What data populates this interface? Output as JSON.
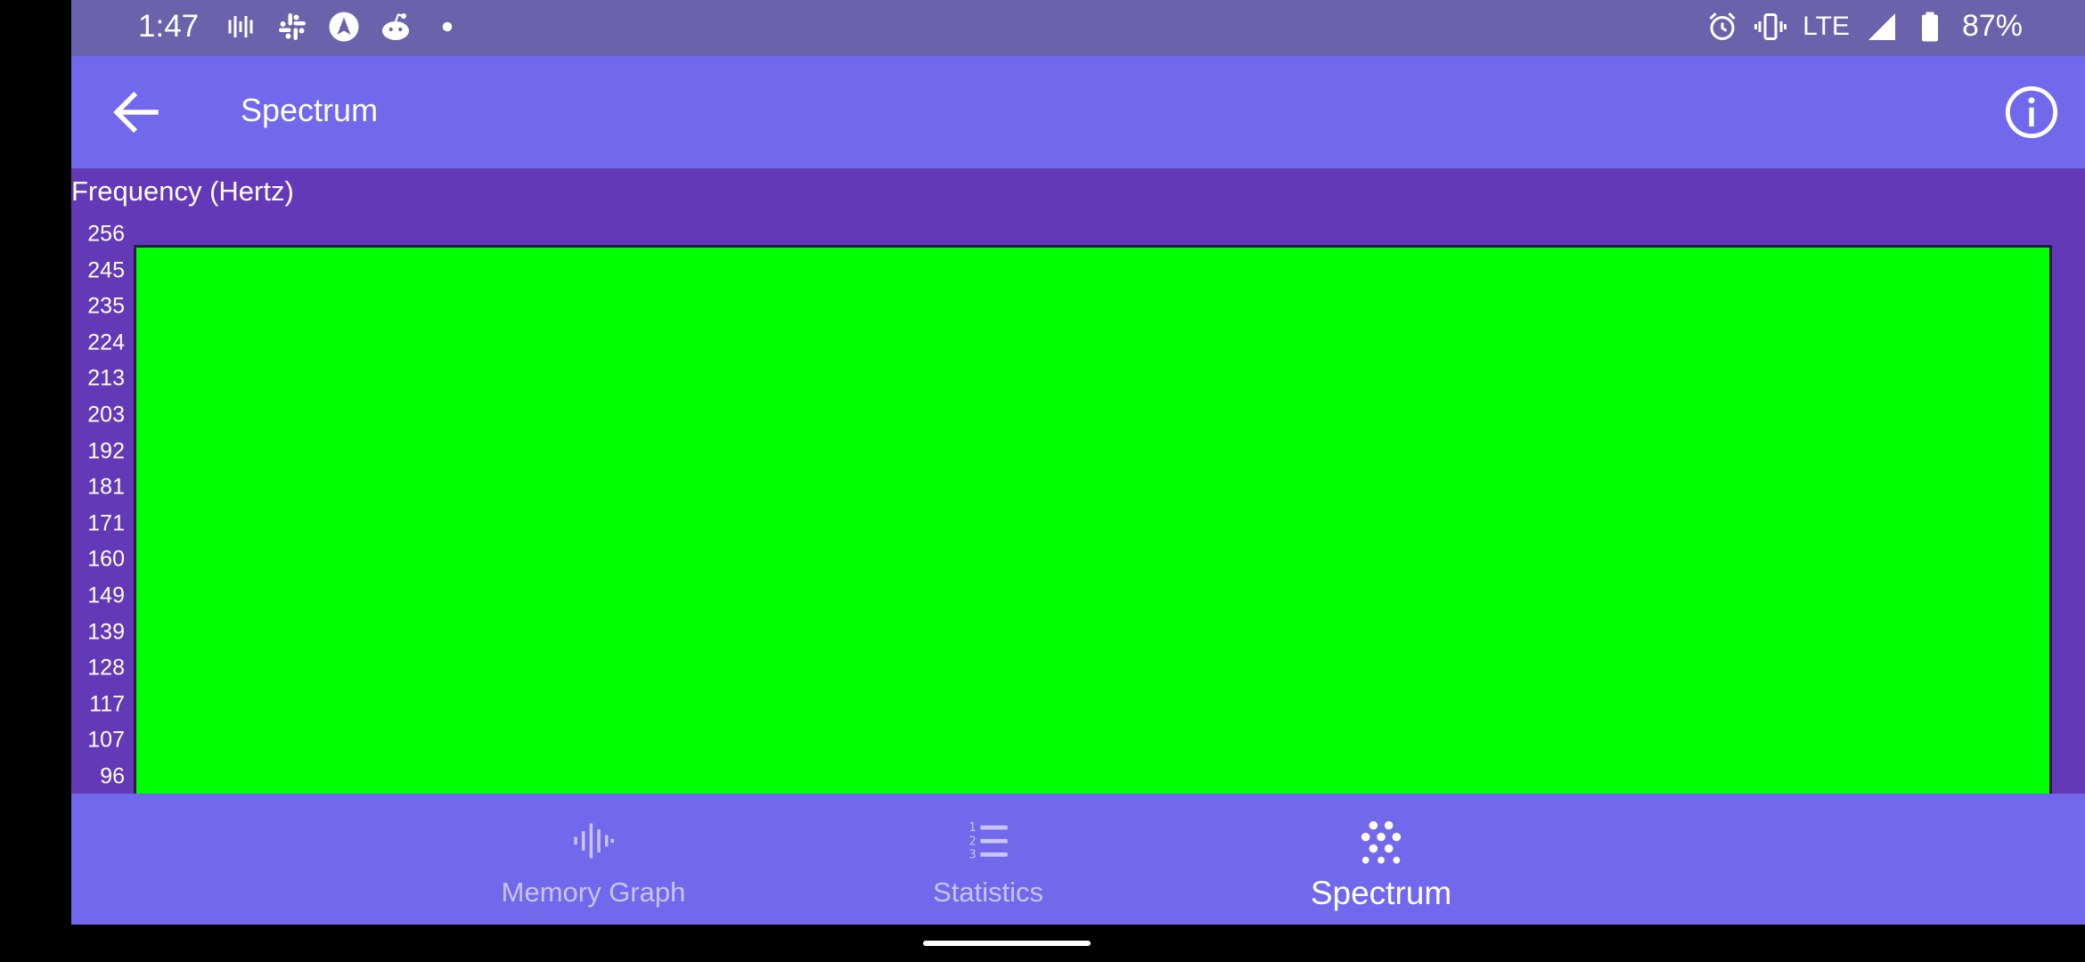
{
  "status_bar": {
    "time": "1:47",
    "left_icons": [
      "soundwave-icon",
      "slack-icon",
      "navigation-icon",
      "reddit-icon",
      "dot-icon"
    ],
    "network": "LTE",
    "battery": "87%",
    "right_icons": [
      "alarm-icon",
      "vibrate-icon",
      "signal-icon",
      "battery-icon"
    ]
  },
  "app_bar": {
    "title": "Spectrum",
    "back_icon": "arrow-back-icon",
    "info_icon": "info-icon"
  },
  "spectrum": {
    "y_axis_label": "Frequency (Hertz)",
    "y_ticks": [
      "256",
      "245",
      "235",
      "224",
      "213",
      "203",
      "192",
      "181",
      "171",
      "160",
      "149",
      "139",
      "128",
      "117",
      "107",
      "96"
    ],
    "fill_color": "#00ff00"
  },
  "bottom_nav": {
    "items": [
      {
        "label": "Memory Graph",
        "icon": "waveform-icon",
        "active": false
      },
      {
        "label": "Statistics",
        "icon": "numbered-list-icon",
        "active": false
      },
      {
        "label": "Spectrum",
        "icon": "dots-grid-icon",
        "active": true
      }
    ]
  },
  "colors": {
    "status_bar": "#6a63ab",
    "app_bar": "#7168ec",
    "content_bg": "#6439b7",
    "plot": "#00ff00"
  }
}
